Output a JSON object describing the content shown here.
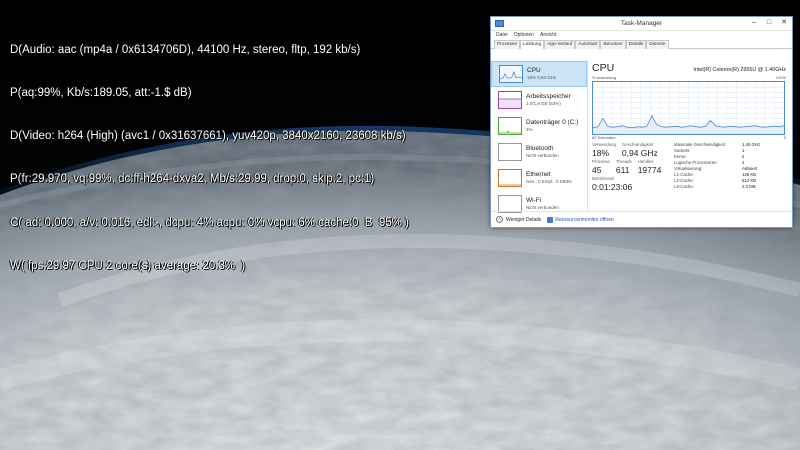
{
  "overlay": {
    "lines": [
      "D(Audio: aac (mp4a / 0x6134706D), 44100 Hz, stereo, fltp, 192 kb/s)",
      "P(aq:99%, Kb/s:189.05, att:-1.$ dB)",
      "D(Video: h264 (High) (avc1 / 0x31637661), yuv420p, 3840x2160, 23608 kb/s)",
      "P(fr:29.970, vq:99%, dc:ff-h264-dxva2, Mb/s:29.99, drop:0, skip:2, pc:1)",
      "C( ad: 0.000, a/v: 0.016, edl:-, dcpu: 4% acpu: 0% vcpu: 6% cache:0  B  95% )",
      "W( fps:29.97 CPU 2 core(s) average: 20.3%  )"
    ]
  },
  "task_manager": {
    "title": "Task-Manager",
    "window_controls": {
      "minimize": "–",
      "maximize": "□",
      "close": "✕"
    },
    "menu": [
      "Datei",
      "Optionen",
      "Ansicht"
    ],
    "tabs": [
      "Prozesse",
      "Leistung",
      "App-Verlauf",
      "Autostart",
      "Benutzer",
      "Details",
      "Dienste"
    ],
    "active_tab": "Leistung",
    "sidebar": [
      {
        "name": "CPU",
        "sub": "18% 0,94 GHz",
        "active": true,
        "icon": "cpu-mini-graph"
      },
      {
        "name": "Arbeitsspeicher",
        "sub": "1,0/1,9 GB (53%)",
        "active": false,
        "icon": "memory-mini-graph"
      },
      {
        "name": "Datenträger 0 (C:)",
        "sub": "3%",
        "active": false,
        "icon": "disk-mini-graph"
      },
      {
        "name": "Bluetooth",
        "sub": "Nicht verbunden",
        "active": false,
        "icon": "bluetooth-mini-graph"
      },
      {
        "name": "Ethernet",
        "sub": "Ges.: 0 Empf.: 0 KBit/s",
        "active": false,
        "icon": "ethernet-mini-graph"
      },
      {
        "name": "Wi-Fi",
        "sub": "Nicht verbunden",
        "active": false,
        "icon": "wifi-mini-graph"
      }
    ],
    "main": {
      "heading": "CPU",
      "processor": "Intel(R) Celeron(R) 2955U @ 1.40GHz",
      "graph_top_left": "% Auslastung",
      "graph_top_right": "100%",
      "graph_bottom_left": "60 Sekunden",
      "graph_bottom_right": "0",
      "utilization_history": [
        12,
        14,
        30,
        15,
        13,
        14,
        16,
        13,
        12,
        14,
        13,
        15,
        35,
        18,
        14,
        13,
        14,
        15,
        13,
        14,
        16,
        14,
        13,
        15,
        26,
        16,
        14,
        13,
        15,
        14,
        13,
        14,
        15,
        16,
        14,
        13,
        14,
        15,
        14,
        16
      ],
      "stats": {
        "verwendung_label": "Verwendung",
        "verwendung": "18%",
        "geschwindigkeit_label": "Geschwindigkeit",
        "geschwindigkeit": "0,94 GHz",
        "prozesse_label": "Prozesse",
        "prozesse": "45",
        "threads_label": "Threads",
        "threads": "611",
        "handles_label": "Handles",
        "handles": "19774",
        "betriebszeit_label": "Betriebszeit",
        "betriebszeit": "0:01:23:06"
      },
      "details": [
        {
          "k": "Maximale Geschwindigkeit:",
          "v": "1,40 GHz"
        },
        {
          "k": "Sockets:",
          "v": "1"
        },
        {
          "k": "Kerne:",
          "v": "2"
        },
        {
          "k": "Logische Prozessoren:",
          "v": "2"
        },
        {
          "k": "Virtualisierung:",
          "v": "Aktiviert"
        },
        {
          "k": "L1-Cache:",
          "v": "128 KB"
        },
        {
          "k": "L2-Cache:",
          "v": "512 KB"
        },
        {
          "k": "L3-Cache:",
          "v": "2,0 MB"
        }
      ]
    },
    "footer": {
      "fewer_details": "Weniger Details",
      "resource_monitor": "Ressourcenmonitor öffnen"
    },
    "colors": {
      "cpu": "#4b8bd4",
      "memory": "#a23dbb",
      "disk": "#4fa43a",
      "ethernet": "#c87724"
    }
  }
}
